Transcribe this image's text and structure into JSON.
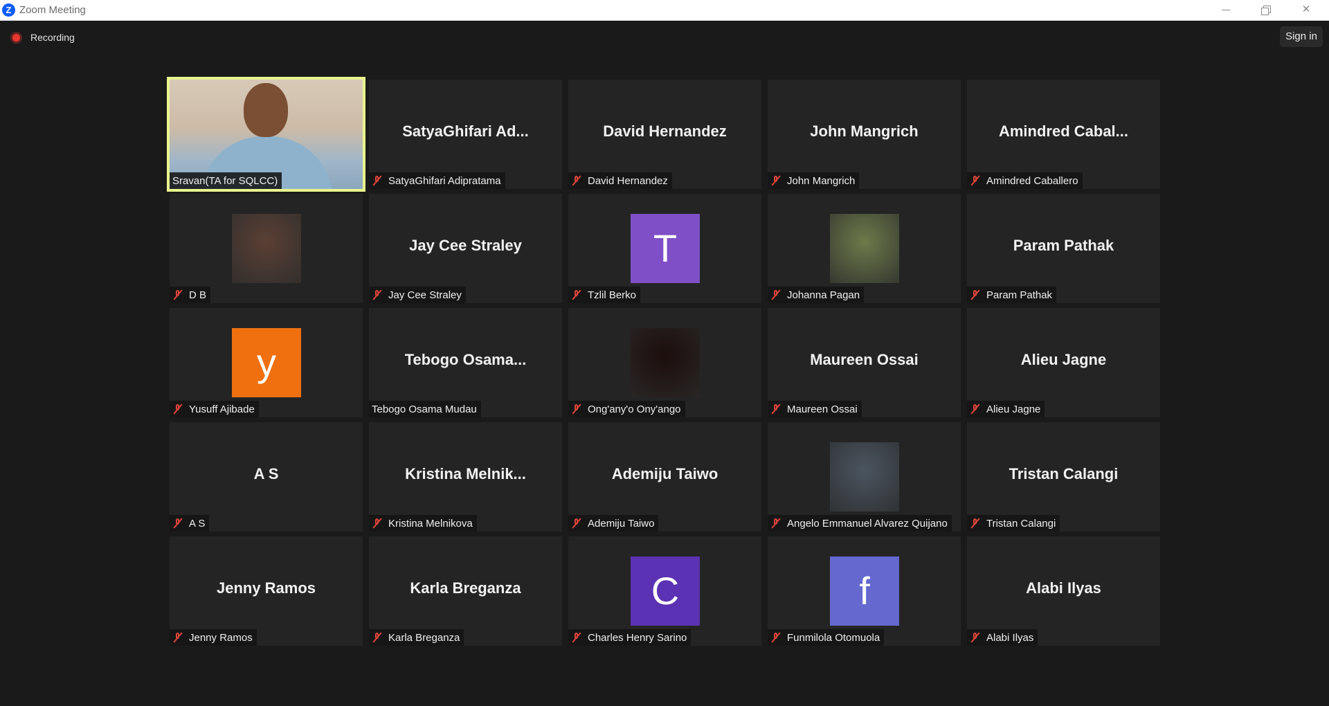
{
  "window": {
    "title": "Zoom Meeting"
  },
  "recording": {
    "label": "Recording"
  },
  "signin": {
    "label": "Sign in"
  },
  "participants": [
    {
      "display": "video",
      "tag": "Sravan(TA for SQLCC)",
      "muted": false,
      "active": true
    },
    {
      "display": "name",
      "big": "SatyaGhifari  Ad...",
      "tag": "SatyaGhifari Adipratama",
      "muted": true
    },
    {
      "display": "name",
      "big": "David Hernandez",
      "tag": "David Hernandez",
      "muted": true
    },
    {
      "display": "name",
      "big": "John Mangrich",
      "tag": "John Mangrich",
      "muted": true
    },
    {
      "display": "name",
      "big": "Amindred  Cabal...",
      "tag": "Amindred Caballero",
      "muted": true
    },
    {
      "display": "photo",
      "photo_color": "#5a4034",
      "tag": "D B",
      "muted": true
    },
    {
      "display": "name",
      "big": "Jay Cee Straley",
      "tag": "Jay Cee Straley",
      "muted": true
    },
    {
      "display": "letter",
      "letter": "T",
      "color": "#7e4fc7",
      "tag": "Tzlil Berko",
      "muted": true
    },
    {
      "display": "photo",
      "photo_color": "#6d7a4a",
      "tag": "Johanna Pagan",
      "muted": true
    },
    {
      "display": "name",
      "big": "Param Pathak",
      "tag": "Param Pathak",
      "muted": true
    },
    {
      "display": "letter",
      "letter": "y",
      "color": "#f07010",
      "tag": "Yusuff Ajibade",
      "muted": true
    },
    {
      "display": "name",
      "big": "Tebogo  Osama...",
      "tag": "Tebogo Osama Mudau",
      "muted": false
    },
    {
      "display": "photo",
      "photo_color": "#1c0e0c",
      "tag": "Ong'any'o Ony'ango",
      "muted": true
    },
    {
      "display": "name",
      "big": "Maureen Ossai",
      "tag": "Maureen Ossai",
      "muted": true
    },
    {
      "display": "name",
      "big": "Alieu Jagne",
      "tag": "Alieu Jagne",
      "muted": true
    },
    {
      "display": "name",
      "big": "A S",
      "tag": "A S",
      "muted": true
    },
    {
      "display": "name",
      "big": "Kristina  Melnik...",
      "tag": "Kristina Melnikova",
      "muted": true
    },
    {
      "display": "name",
      "big": "Ademiju Taiwo",
      "tag": "Ademiju Taiwo",
      "muted": true
    },
    {
      "display": "photo",
      "photo_color": "#4a5560",
      "tag": "Angelo Emmanuel Alvarez Quijano",
      "muted": true
    },
    {
      "display": "name",
      "big": "Tristan Calangi",
      "tag": "Tristan Calangi",
      "muted": true
    },
    {
      "display": "name",
      "big": "Jenny Ramos",
      "tag": "Jenny Ramos",
      "muted": true
    },
    {
      "display": "name",
      "big": "Karla Breganza",
      "tag": "Karla Breganza",
      "muted": true
    },
    {
      "display": "letter",
      "letter": "C",
      "color": "#5b32b3",
      "tag": "Charles Henry Sarino",
      "muted": true
    },
    {
      "display": "letter",
      "letter": "f",
      "color": "#6468cf",
      "tag": "Funmilola Otomuola",
      "muted": true
    },
    {
      "display": "name",
      "big": "Alabi Ilyas",
      "tag": "Alabi Ilyas",
      "muted": true
    }
  ]
}
